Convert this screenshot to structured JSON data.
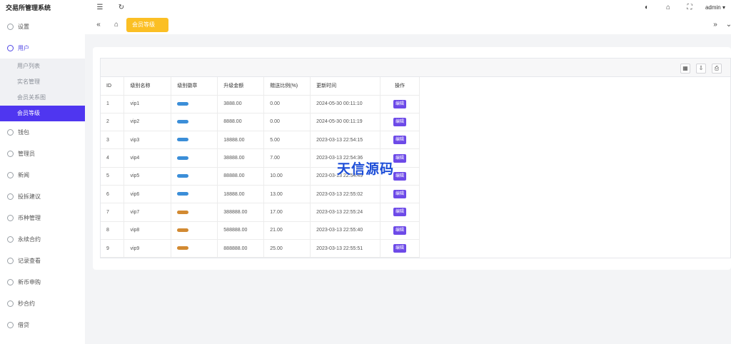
{
  "app": {
    "title": "交易所管理系统"
  },
  "sidebar": {
    "items": [
      {
        "label": "设置"
      },
      {
        "label": "用户"
      },
      {
        "label": "钱包"
      },
      {
        "label": "管理员"
      },
      {
        "label": "新闻"
      },
      {
        "label": "投拆建议"
      },
      {
        "label": "币种管理"
      },
      {
        "label": "永续合约"
      },
      {
        "label": "记录查看"
      },
      {
        "label": "新币申购"
      },
      {
        "label": "秒合约"
      },
      {
        "label": "借贷"
      }
    ],
    "user_submenu": [
      {
        "label": "用户列表"
      },
      {
        "label": "实名管理"
      },
      {
        "label": "会员关系图"
      },
      {
        "label": "会员等级"
      }
    ]
  },
  "header": {
    "admin_label": "admin"
  },
  "tabs": {
    "active_label": "会员等级"
  },
  "table": {
    "columns": [
      "ID",
      "级别名称",
      "级别徽章",
      "升级金额",
      "赠送比例(%)",
      "更新时间",
      "操作"
    ],
    "edit_label": "编辑",
    "rows": [
      {
        "id": "1",
        "name": "vip1",
        "badge": "blue",
        "amount": "3888.00",
        "ratio": "0.00",
        "time": "2024-05-30 00:11:10"
      },
      {
        "id": "2",
        "name": "vip2",
        "badge": "blue",
        "amount": "8888.00",
        "ratio": "0.00",
        "time": "2024-05-30 00:11:19"
      },
      {
        "id": "3",
        "name": "vip3",
        "badge": "blue",
        "amount": "18888.00",
        "ratio": "5.00",
        "time": "2023-03-13 22:54:15"
      },
      {
        "id": "4",
        "name": "vip4",
        "badge": "blue",
        "amount": "38888.00",
        "ratio": "7.00",
        "time": "2023-03-13 22:54:36"
      },
      {
        "id": "5",
        "name": "vip5",
        "badge": "blue",
        "amount": "88888.00",
        "ratio": "10.00",
        "time": "2023-03-13 22:54:49"
      },
      {
        "id": "6",
        "name": "vip6",
        "badge": "blue",
        "amount": "18888.00",
        "ratio": "13.00",
        "time": "2023-03-13 22:55:02"
      },
      {
        "id": "7",
        "name": "vip7",
        "badge": "gold",
        "amount": "388888.00",
        "ratio": "17.00",
        "time": "2023-03-13 22:55:24"
      },
      {
        "id": "8",
        "name": "vip8",
        "badge": "gold",
        "amount": "588888.00",
        "ratio": "21.00",
        "time": "2023-03-13 22:55:40"
      },
      {
        "id": "9",
        "name": "vip9",
        "badge": "gold",
        "amount": "888888.00",
        "ratio": "25.00",
        "time": "2023-03-13 22:55:51"
      }
    ]
  },
  "watermark": "天信源码",
  "colors": {
    "accent": "#4f36f0",
    "tab": "#fbbf24",
    "edit": "#6d4ae8",
    "badge_blue": "#3b8ed8",
    "badge_gold": "#d28a32"
  }
}
